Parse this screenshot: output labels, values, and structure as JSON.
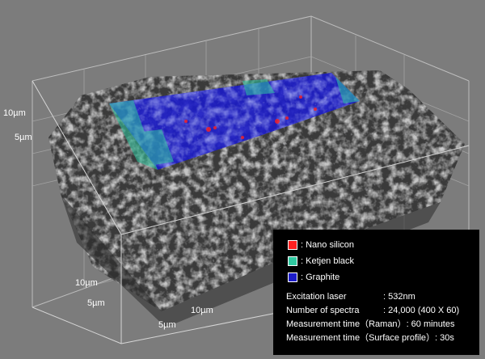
{
  "colors": {
    "background": "#7c7c7c",
    "surface_dark": "#3a3a3a",
    "nano_silicon": "#ff2020",
    "ketjen_black": "#2ec8a0",
    "graphite": "#1c1cc8",
    "panel": "#000000",
    "text": "#ffffff"
  },
  "axis_labels": {
    "z_upper": "10µm",
    "z_lower": "5µm",
    "y_upper": "10µm",
    "y_lower": "5µm",
    "x_upper": "10µm",
    "x_lower": "5µm"
  },
  "legend": {
    "items": [
      {
        "label": ": Nano silicon",
        "color": "#ff2020"
      },
      {
        "label": ": Ketjen black",
        "color": "#2ec8a0"
      },
      {
        "label": ": Graphite",
        "color": "#1c1cc8"
      }
    ]
  },
  "specs": [
    {
      "key": "Excitation laser",
      "value": ": 532nm"
    },
    {
      "key": "Number of spectra",
      "value": ": 24,000 (400 X 60)"
    },
    {
      "key": "Measurement time（Raman）",
      "value": ":  60 minutes"
    },
    {
      "key": "Measurement time（Surface profile）",
      "value": ": 30s"
    }
  ]
}
